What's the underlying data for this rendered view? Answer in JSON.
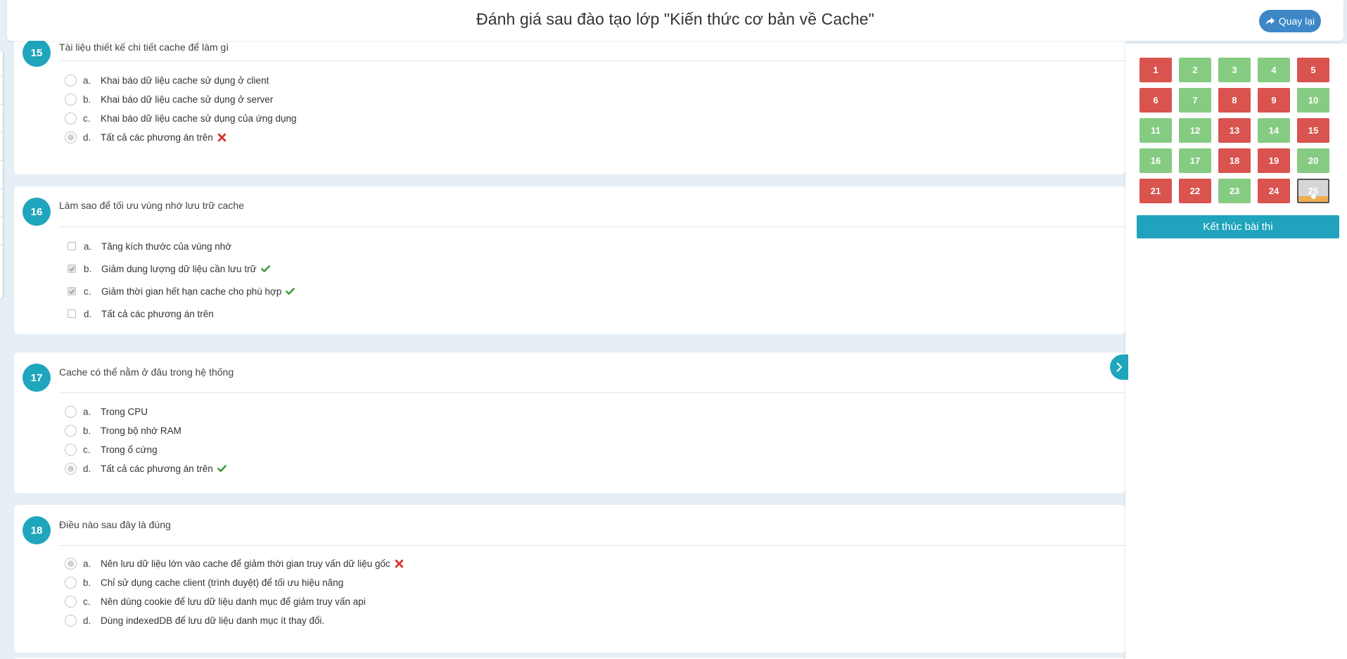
{
  "header": {
    "title": "Đánh giá sau đào tạo lớp \"Kiến thức cơ bản về Cache\"",
    "back_label": "Quay lại"
  },
  "questions": [
    {
      "number": "15",
      "text": "Tài liệu thiết kế chi tiết cache để làm gì",
      "input_type": "radio",
      "options": [
        {
          "letter": "a.",
          "text": "Khai báo dữ liệu cache sử dụng ở client",
          "selected": false,
          "mark": ""
        },
        {
          "letter": "b.",
          "text": "Khai báo dữ liệu cache sử dụng ở server",
          "selected": false,
          "mark": ""
        },
        {
          "letter": "c.",
          "text": "Khai báo dữ liệu cache sử dụng của ứng dụng",
          "selected": false,
          "mark": ""
        },
        {
          "letter": "d.",
          "text": "Tất cả các phương án trên",
          "selected": true,
          "mark": "wrong"
        }
      ]
    },
    {
      "number": "16",
      "text": "Làm sao để tối ưu vùng nhớ lưu trữ cache",
      "input_type": "checkbox",
      "options": [
        {
          "letter": "a.",
          "text": "Tăng kích thước của vùng nhớ",
          "selected": false,
          "mark": ""
        },
        {
          "letter": "b.",
          "text": "Giảm dung lượng dữ liệu cần lưu trữ",
          "selected": true,
          "mark": "correct"
        },
        {
          "letter": "c.",
          "text": "Giảm thời gian hết hạn cache cho phù hợp",
          "selected": true,
          "mark": "correct"
        },
        {
          "letter": "d.",
          "text": "Tất cả các phương án trên",
          "selected": false,
          "mark": ""
        }
      ]
    },
    {
      "number": "17",
      "text": "Cache có thể nằm ở đâu trong hệ thống",
      "input_type": "radio",
      "options": [
        {
          "letter": "a.",
          "text": "Trong CPU",
          "selected": false,
          "mark": ""
        },
        {
          "letter": "b.",
          "text": "Trong bộ nhớ RAM",
          "selected": false,
          "mark": ""
        },
        {
          "letter": "c.",
          "text": "Trong ổ cứng",
          "selected": false,
          "mark": ""
        },
        {
          "letter": "d.",
          "text": "Tất cả các phương án trên",
          "selected": true,
          "mark": "correct"
        }
      ]
    },
    {
      "number": "18",
      "text": "Điều nào sau đây là đúng",
      "input_type": "radio",
      "options": [
        {
          "letter": "a.",
          "text": "Nên lưu dữ liệu lớn vào cache để giảm thời gian truy vấn dữ liệu gốc",
          "selected": true,
          "mark": "wrong"
        },
        {
          "letter": "b.",
          "text": "Chỉ sử dụng cache client (trình duyệt) để tối ưu hiệu năng",
          "selected": false,
          "mark": ""
        },
        {
          "letter": "c.",
          "text": "Nên dùng cookie để lưu dữ liệu danh mục để giảm truy vấn api",
          "selected": false,
          "mark": ""
        },
        {
          "letter": "d.",
          "text": "Dùng indexedDB để lưu dữ liệu danh mục ít thay đổi.",
          "selected": false,
          "mark": ""
        }
      ]
    }
  ],
  "navigator": {
    "cells": [
      {
        "label": "1",
        "status": "red"
      },
      {
        "label": "2",
        "status": "green"
      },
      {
        "label": "3",
        "status": "green"
      },
      {
        "label": "4",
        "status": "green"
      },
      {
        "label": "5",
        "status": "red"
      },
      {
        "label": "6",
        "status": "red"
      },
      {
        "label": "7",
        "status": "green"
      },
      {
        "label": "8",
        "status": "red"
      },
      {
        "label": "9",
        "status": "red"
      },
      {
        "label": "10",
        "status": "green"
      },
      {
        "label": "11",
        "status": "green"
      },
      {
        "label": "12",
        "status": "green"
      },
      {
        "label": "13",
        "status": "red"
      },
      {
        "label": "14",
        "status": "green"
      },
      {
        "label": "15",
        "status": "red"
      },
      {
        "label": "16",
        "status": "green"
      },
      {
        "label": "17",
        "status": "green"
      },
      {
        "label": "18",
        "status": "red"
      },
      {
        "label": "19",
        "status": "red"
      },
      {
        "label": "20",
        "status": "green"
      },
      {
        "label": "21",
        "status": "red"
      },
      {
        "label": "22",
        "status": "red"
      },
      {
        "label": "23",
        "status": "green"
      },
      {
        "label": "24",
        "status": "red"
      },
      {
        "label": "25",
        "status": "current"
      }
    ],
    "finish_label": "Kết thúc bài thi"
  },
  "colors": {
    "accent": "#1fa5bc",
    "correct_cell": "#86cb82",
    "wrong_cell": "#d9534f",
    "back_button": "#3d87c6",
    "correct_mark": "#3a9d3a",
    "wrong_mark": "#d9342b"
  }
}
